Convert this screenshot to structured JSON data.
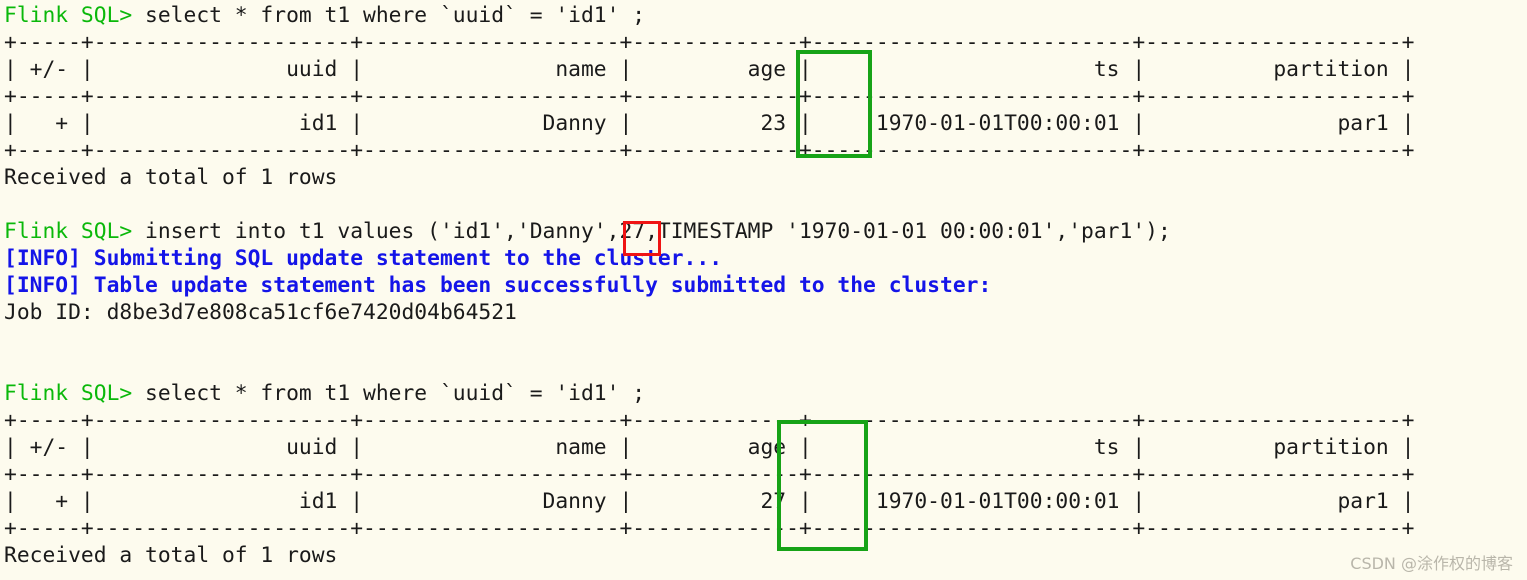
{
  "terminal": {
    "background_color": "#fdfbee",
    "text_color": "#1a1a1a",
    "prompt_color": "#0ab80a",
    "info_color": "#1414e8",
    "prompt_label": "Flink SQL>",
    "lines": [
      {
        "id": "l01",
        "kind": "prompt",
        "prompt": "Flink SQL>",
        "text": " select * from t1 where `uuid` = 'id1' ;"
      },
      {
        "id": "l02",
        "kind": "rule",
        "text": "+-----+--------------------+--------------------+-------------+-------------------------+--------------------+"
      },
      {
        "id": "l03",
        "kind": "row",
        "text": "| +/- |               uuid |               name |         age |                      ts |          partition |"
      },
      {
        "id": "l04",
        "kind": "rule",
        "text": "+-----+--------------------+--------------------+-------------+-------------------------+--------------------+"
      },
      {
        "id": "l05",
        "kind": "row",
        "text": "|   + |                id1 |              Danny |          23 |     1970-01-01T00:00:01 |               par1 |"
      },
      {
        "id": "l06",
        "kind": "rule",
        "text": "+-----+--------------------+--------------------+-------------+-------------------------+--------------------+"
      },
      {
        "id": "l07",
        "kind": "plain",
        "text": "Received a total of 1 rows"
      },
      {
        "id": "l08",
        "kind": "blank",
        "text": ""
      },
      {
        "id": "l09",
        "kind": "prompt",
        "prompt": "Flink SQL>",
        "text": " insert into t1 values ('id1','Danny',27,TIMESTAMP '1970-01-01 00:00:01','par1');"
      },
      {
        "id": "l10",
        "kind": "info",
        "text": "[INFO] Submitting SQL update statement to the cluster..."
      },
      {
        "id": "l11",
        "kind": "info",
        "text": "[INFO] Table update statement has been successfully submitted to the cluster:"
      },
      {
        "id": "l12",
        "kind": "plain",
        "text": "Job ID: d8be3d7e808ca51cf6e7420d04b64521"
      },
      {
        "id": "l13",
        "kind": "blank",
        "text": ""
      },
      {
        "id": "l14",
        "kind": "blank",
        "text": ""
      },
      {
        "id": "l15",
        "kind": "prompt",
        "prompt": "Flink SQL>",
        "text": " select * from t1 where `uuid` = 'id1' ;"
      },
      {
        "id": "l16",
        "kind": "rule",
        "text": "+-----+--------------------+--------------------+-------------+-------------------------+--------------------+"
      },
      {
        "id": "l17",
        "kind": "row",
        "text": "| +/- |               uuid |               name |         age |                      ts |          partition |"
      },
      {
        "id": "l18",
        "kind": "rule",
        "text": "+-----+--------------------+--------------------+-------------+-------------------------+--------------------+"
      },
      {
        "id": "l19",
        "kind": "row",
        "text": "|   + |                id1 |              Danny |          27 |     1970-01-01T00:00:01 |               par1 |"
      },
      {
        "id": "l20",
        "kind": "rule",
        "text": "+-----+--------------------+--------------------+-------------+-------------------------+--------------------+"
      },
      {
        "id": "l21",
        "kind": "plain",
        "text": "Received a total of 1 rows"
      }
    ]
  },
  "query": {
    "select_statement": "select * from t1 where `uuid` = 'id1' ;",
    "insert_statement": "insert into t1 values ('id1','Danny',27,TIMESTAMP '1970-01-01 00:00:01','par1');",
    "job_id": "d8be3d7e808ca51cf6e7420d04b64521",
    "row_count_message": "Received a total of 1 rows"
  },
  "result_table_before": {
    "columns": [
      "+/-",
      "uuid",
      "name",
      "age",
      "ts",
      "partition"
    ],
    "rows": [
      [
        "+",
        "id1",
        "Danny",
        "23",
        "1970-01-01T00:00:01",
        "par1"
      ]
    ],
    "footer": "Received a total of 1 rows"
  },
  "result_table_after": {
    "columns": [
      "+/-",
      "uuid",
      "name",
      "age",
      "ts",
      "partition"
    ],
    "rows": [
      [
        "+",
        "id1",
        "Danny",
        "27",
        "1970-01-01T00:00:01",
        "par1"
      ]
    ],
    "footer": "Received a total of 1 rows"
  },
  "annotations": {
    "green_color": "#17a317",
    "red_color": "#ef1414",
    "boxes": [
      {
        "id": "age-before-highlight",
        "color": "#17a317",
        "label": "age column before update (23)"
      },
      {
        "id": "age-inserted-highlight",
        "color": "#ef1414",
        "label": "inserted age value (27)"
      },
      {
        "id": "age-after-highlight",
        "color": "#17a317",
        "label": "age column after update (27)"
      }
    ]
  },
  "watermark": {
    "text": "CSDN @涂作权的博客"
  }
}
